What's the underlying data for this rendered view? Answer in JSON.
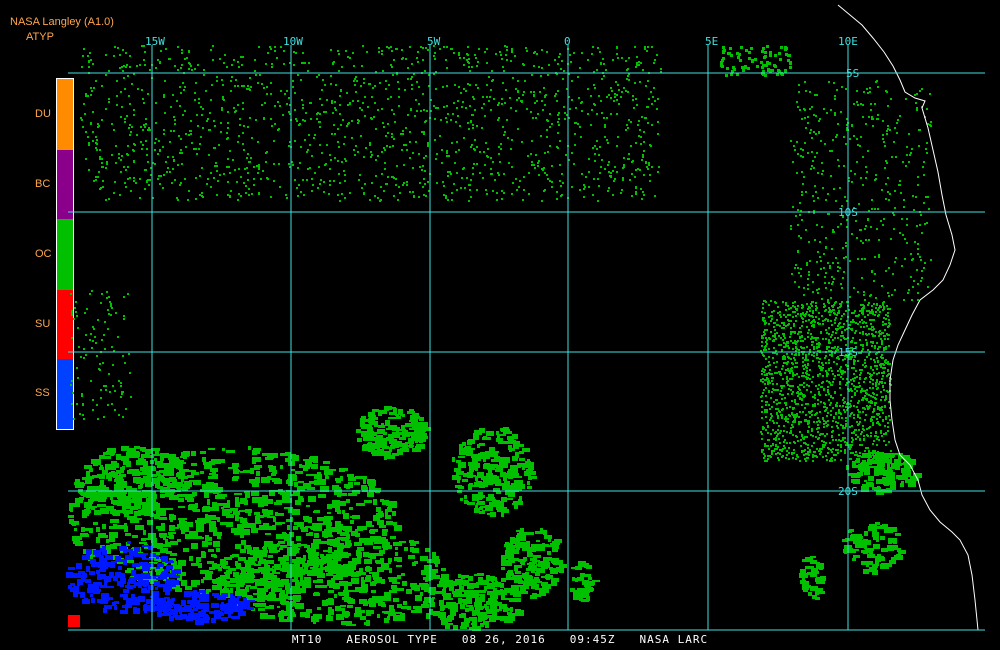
{
  "header": {
    "title": "NASA Langley (A1.0)",
    "product": "ATYP"
  },
  "legend": {
    "items": [
      {
        "code": "DU",
        "color": "#ff8c00"
      },
      {
        "code": "BC",
        "color": "#8b008b"
      },
      {
        "code": "OC",
        "color": "#00c000"
      },
      {
        "code": "SU",
        "color": "#ff0000"
      },
      {
        "code": "SS",
        "color": "#0040ff"
      }
    ]
  },
  "map": {
    "lon_labels": [
      "15W",
      "10W",
      "5W",
      "0",
      "5E",
      "10E"
    ],
    "lat_labels": [
      "5S",
      "10S",
      "15S",
      "20S"
    ],
    "grid_color": "#40e0e0",
    "coast_color": "#ffffff"
  },
  "footer": {
    "satellite": "MT10",
    "product": "AEROSOL TYPE",
    "date": "08 26, 2016",
    "time": "09:45Z",
    "source": "NASA LARC"
  }
}
